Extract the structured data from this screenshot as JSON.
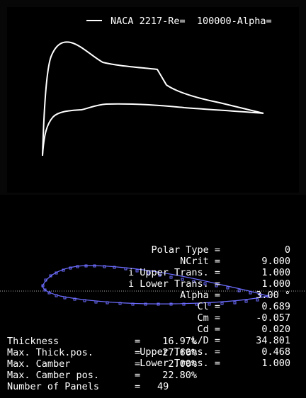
{
  "legend": {
    "label": "NACA 2217-Re=  100000-Alpha="
  },
  "colors": {
    "background": "#000000",
    "plot_background": "#070707",
    "foil_overlay": "#6c6cff",
    "text": "#ffffff"
  },
  "polar_params": [
    {
      "label": "Polar Type =",
      "value": "0"
    },
    {
      "label": "NCrit =",
      "value": "9.000"
    },
    {
      "label": "i Upper Trans. =",
      "value": "1.000"
    },
    {
      "label": "i Lower Trans. =",
      "value": "1.000"
    },
    {
      "label": "Alpha =",
      "value": "3.00 °"
    },
    {
      "label": "Cl =",
      "value": "0.689"
    },
    {
      "label": "Cm =",
      "value": "-0.057"
    },
    {
      "label": "Cd =",
      "value": "0.020"
    },
    {
      "label": "L/D =",
      "value": "34.801"
    },
    {
      "label": "Upper Trans. =",
      "value": "0.468"
    },
    {
      "label": "Lower Trans. =",
      "value": "1.000"
    }
  ],
  "foil_params": [
    {
      "label": "Thickness",
      "eq": "=",
      "value": "16.97%"
    },
    {
      "label": "Max. Thick.pos.",
      "eq": "=",
      "value": "27.60%"
    },
    {
      "label": "Max. Camber",
      "eq": "=",
      "value": "2.00%"
    },
    {
      "label": "Max. Camber pos.",
      "eq": "=",
      "value": "22.80%"
    },
    {
      "label": "Number of Panels",
      "eq": "=",
      "value": "49"
    }
  ]
}
